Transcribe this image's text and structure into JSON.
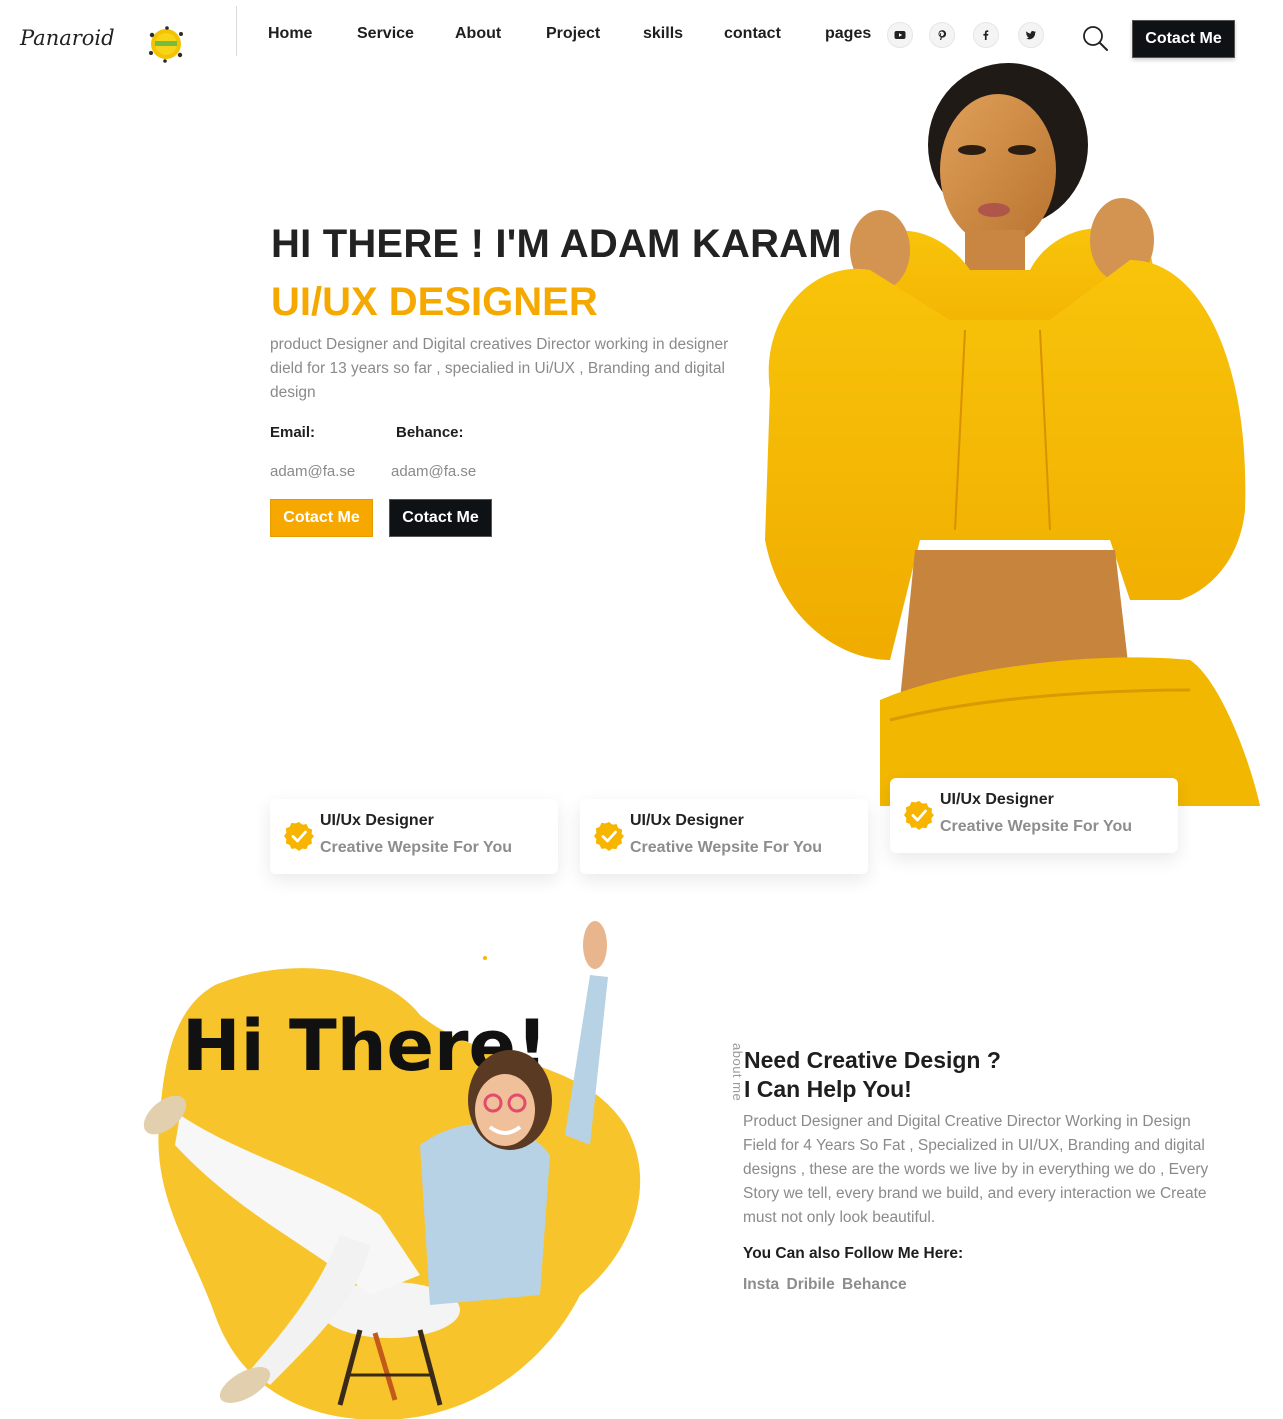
{
  "header": {
    "logo": "Panaroid",
    "nav": [
      {
        "label": "Home"
      },
      {
        "label": "Service"
      },
      {
        "label": "About"
      },
      {
        "label": "Project"
      },
      {
        "label": "skills"
      },
      {
        "label": "contact"
      },
      {
        "label": "pages"
      }
    ],
    "social_icons": [
      "youtube-icon",
      "pinterest-icon",
      "facebook-icon",
      "twitter-icon"
    ],
    "cta": "Cotact Me"
  },
  "hero": {
    "title": "HI THERE ! I'M ADAM KARAM",
    "role": "UI/UX DESIGNER",
    "description": "product Designer and Digital creatives Director working in designer dield for 13 years so far , specialied in Ui/UX , Branding and digital design",
    "email_label": "Email:",
    "behance_label": "Behance:",
    "email_value": "adam@fa.se",
    "behance_value": "adam@fa.se",
    "primary_button": "Cotact Me",
    "secondary_button": "Cotact Me"
  },
  "features": [
    {
      "title": "UI/Ux Designer",
      "subtitle": "Creative Wepsite For You"
    },
    {
      "title": "UI/Ux Designer",
      "subtitle": "Creative Wepsite For You"
    },
    {
      "title": "UI/Ux Designer",
      "subtitle": "Creative Wepsite For You"
    }
  ],
  "about": {
    "image_text": "Hi There!",
    "vertical_label": "about me",
    "title_line1": "Need Creative Design ?",
    "title_line2": "I Can Help You!",
    "description": "Product Designer and Digital Creative Director Working in Design Field for 4 Years So Fat , Specialized in UI/UX, Branding and digital designs , these are the words we live by in everything we do , Every Story we tell, every brand we build, and every interaction we Create must not only look beautiful.",
    "follow_label": "You Can also Follow Me Here:",
    "follow_links": [
      "Insta",
      "Dribile",
      "Behance"
    ]
  },
  "colors": {
    "accent": "#f7a800",
    "dark": "#0f1215",
    "muted_text": "#8a8a8a"
  }
}
